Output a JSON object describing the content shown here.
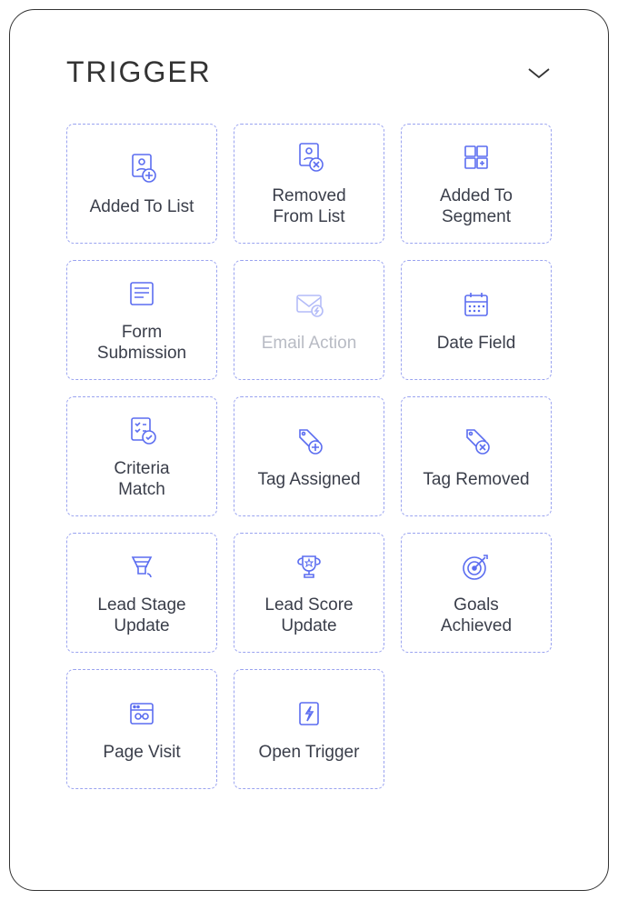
{
  "header": {
    "title": "TRIGGER"
  },
  "triggers": [
    {
      "label": "Added To List",
      "icon": "list-add-icon",
      "disabled": false
    },
    {
      "label": "Removed\nFrom List",
      "icon": "list-remove-icon",
      "disabled": false
    },
    {
      "label": "Added To\nSegment",
      "icon": "segment-add-icon",
      "disabled": false
    },
    {
      "label": "Form\nSubmission",
      "icon": "form-icon",
      "disabled": false
    },
    {
      "label": "Email Action",
      "icon": "email-action-icon",
      "disabled": true
    },
    {
      "label": "Date Field",
      "icon": "calendar-icon",
      "disabled": false
    },
    {
      "label": "Criteria\nMatch",
      "icon": "checklist-icon",
      "disabled": false
    },
    {
      "label": "Tag Assigned",
      "icon": "tag-add-icon",
      "disabled": false
    },
    {
      "label": "Tag Removed",
      "icon": "tag-remove-icon",
      "disabled": false
    },
    {
      "label": "Lead Stage\nUpdate",
      "icon": "funnel-icon",
      "disabled": false
    },
    {
      "label": "Lead Score\nUpdate",
      "icon": "trophy-icon",
      "disabled": false
    },
    {
      "label": "Goals\nAchieved",
      "icon": "target-icon",
      "disabled": false
    },
    {
      "label": "Page Visit",
      "icon": "browser-icon",
      "disabled": false
    },
    {
      "label": "Open Trigger",
      "icon": "bolt-icon",
      "disabled": false
    }
  ]
}
